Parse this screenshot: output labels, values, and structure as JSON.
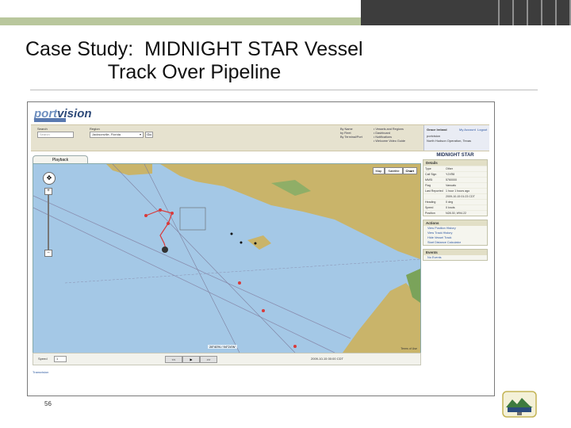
{
  "slide": {
    "title_line1": "Case Study:  MIDNIGHT STAR Vessel",
    "title_line2": "               Track Over Pipeline",
    "page_number": "56"
  },
  "app": {
    "logo_prefix": "port",
    "logo_suffix": "vision",
    "header": {
      "search_label": "Search",
      "search_placeholder": "Search",
      "region_label": "Region",
      "region_value": "Jacksonville, Florida",
      "go_label": "Go",
      "sort_links": "By Name\nby Fleet\nBy Terminal/Port",
      "feature_links": "• Vessels and Regions\n• Dashboard\n• Notifications\n• Welcome Video Guide",
      "user_name": "Grace Ireland",
      "user_account": "portvision",
      "user_location": "North Hudson Operation, Texas",
      "account_link": "My Account",
      "logout_link": "Logout"
    },
    "tab_label": "Playback",
    "map": {
      "buttons": [
        "Map",
        "Satellite",
        "Chart"
      ],
      "zoom_in": "+",
      "zoom_out": "−",
      "scale_text": "28°40'N / 94°24'W",
      "credit": "Terms of Use"
    },
    "playback": {
      "speed_label": "Speed",
      "speed_value": "1",
      "rewind_label": "<<",
      "play_label": "▶",
      "forward_label": ">>",
      "time_readout": "2009-10-15 00:00 CDT"
    },
    "footer_credit": "Transvision",
    "vessel_name": "MIDNIGHT STAR",
    "details": {
      "header": "Details",
      "rows": [
        {
          "k": "Type",
          "v": "Other"
        },
        {
          "k": "Call Sign",
          "v": "YJXR8"
        },
        {
          "k": "MMSI",
          "v": "5760000"
        },
        {
          "k": "Flag",
          "v": "Vanuatu"
        },
        {
          "k": "Last Reported",
          "v": "1 hour 1 hours ago"
        },
        {
          "k": "",
          "v": "2009-10-15 01:23 CDT"
        },
        {
          "k": "Heading",
          "v": "0 deg"
        },
        {
          "k": "Speed",
          "v": "0 knots"
        },
        {
          "k": "Position",
          "v": "N28.30, W94.22"
        }
      ]
    },
    "actions": {
      "header": "Actions",
      "links": [
        "View Position History",
        "View Track History",
        "Hide Vessel Track",
        "Start Distance Calculator"
      ]
    },
    "events": {
      "header": "Events",
      "links": [
        "No Events"
      ]
    }
  },
  "colors": {
    "water": "#a4c8e6",
    "land": "#c9b46a",
    "track": "#d93a3a",
    "accent": "#b9c79d"
  }
}
